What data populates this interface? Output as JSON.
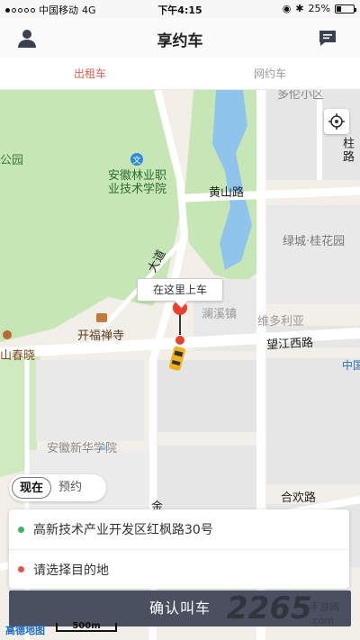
{
  "status_bar": {
    "carrier": "中国移动",
    "network": "4G",
    "time": "下午4:15",
    "battery": "25%",
    "battery_level": 0.25
  },
  "header": {
    "title": "享约车",
    "user_icon": "user-icon",
    "message_icon": "message-icon"
  },
  "tabs": [
    {
      "label": "出租车",
      "active": true
    },
    {
      "label": "网约车",
      "active": false
    }
  ],
  "map": {
    "labels": {
      "community_top": "多伦小区",
      "park": "公园",
      "college": "安徽林业职\n业技术学院",
      "huangshan_road": "黄山路",
      "street_zhu": "柱路",
      "lvcheng": "绿城·桂花园",
      "dadao": "大道",
      "lanxi_town": "澜溪镇",
      "weiduo": "维多利亚",
      "kaifu_temple": "开福禅寺",
      "wangjiang_road": "望江西路",
      "shanchunxiao": "山春晓",
      "zhongguo": "中国",
      "xinhua_college": "安徽新华学院",
      "hehuan_road": "合欢路",
      "jin": "金"
    },
    "pickup_callout": "在这里上车",
    "locate_icon": "locate-icon",
    "brand": "高德地图",
    "scale": "500m",
    "colors": {
      "green": "#c7e6b6",
      "water": "#8fc5ec",
      "block": "#e6e6e6",
      "road": "#ffffff",
      "pin": "#e8412c",
      "taxi": "#f2b01e"
    }
  },
  "time_toggle": {
    "now": "现在",
    "reserve": "预约"
  },
  "addresses": {
    "origin": "高新技术产业开发区红枫路30号",
    "destination_placeholder": "请选择目的地",
    "origin_dot": "#3cb563",
    "destination_dot": "#e0534a"
  },
  "confirm_button": "确认叫车",
  "watermark": {
    "logo": "2265",
    "sub": "手游网",
    "url": ".com"
  }
}
